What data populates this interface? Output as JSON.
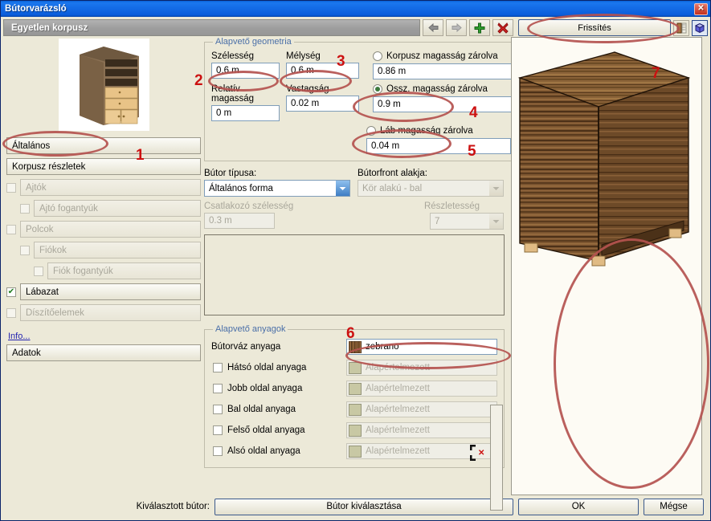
{
  "window": {
    "title": "Bútorvarázsló",
    "close_label": "✕",
    "step_header": "Egyetlen korpusz"
  },
  "toolbar": {
    "back_icon": "arrow-left-icon",
    "forward_icon": "arrow-right-icon",
    "add_icon": "plus-icon",
    "delete_icon": "red-x-icon",
    "refresh_label": "Frissítés",
    "texture_icon": "texture-icon",
    "cube_icon": "cube-3d-icon"
  },
  "sidebar": {
    "items": [
      {
        "label": "Általános",
        "indent": 1,
        "checkbox": "none",
        "enabled": true
      },
      {
        "label": "Korpusz részletek",
        "indent": 1,
        "checkbox": "none",
        "enabled": true
      },
      {
        "label": "Ajtók",
        "indent": 1,
        "checkbox": "unchecked",
        "enabled": false
      },
      {
        "label": "Ajtó fogantyúk",
        "indent": 2,
        "checkbox": "unchecked",
        "enabled": false
      },
      {
        "label": "Polcok",
        "indent": 1,
        "checkbox": "unchecked",
        "enabled": false
      },
      {
        "label": "Fiókok",
        "indent": 2,
        "checkbox": "unchecked",
        "enabled": false
      },
      {
        "label": "Fiók fogantyúk",
        "indent": 3,
        "checkbox": "unchecked",
        "enabled": false
      },
      {
        "label": "Lábazat",
        "indent": 1,
        "checkbox": "checked",
        "enabled": true
      },
      {
        "label": "Díszítőelemek",
        "indent": 1,
        "checkbox": "unchecked",
        "enabled": false
      }
    ],
    "info_link": "Info...",
    "data_button": "Adatok"
  },
  "geometry": {
    "legend": "Alapvető geometria",
    "width_label": "Szélesség",
    "width_value": "0.6 m",
    "depth_label": "Mélység",
    "depth_value": "0.6 m",
    "relative_height_label": "Relatív magasság",
    "relative_height_value": "0 m",
    "thickness_label": "Vastagság",
    "thickness_value": "0.02 m",
    "lock_body_label": "Korpusz magasság zárolva",
    "lock_body_value": "0.86 m",
    "lock_body_selected": false,
    "lock_total_label": "Ossz. magasság zárolva",
    "lock_total_value": "0.9 m",
    "lock_total_selected": true,
    "lock_leg_label": "Láb magasság zárolva",
    "lock_leg_value": "0.04 m",
    "lock_leg_selected": false
  },
  "types": {
    "furniture_type_label": "Bútor típusa:",
    "furniture_type_value": "Általános forma",
    "front_shape_label": "Bútorfront alakja:",
    "front_shape_value": "Kör alakú - bal",
    "connector_width_label": "Csatlakozó szélesség",
    "connector_width_value": "0.3 m",
    "detail_label": "Részletesség",
    "detail_value": "7"
  },
  "materials": {
    "legend": "Alapvető anyagok",
    "frame_label": "Bútorváz anyaga",
    "frame_value": "zebrano",
    "rows": [
      {
        "label": "Hátsó oldal anyaga",
        "value": "Alapértelmezett",
        "checked": false
      },
      {
        "label": "Jobb oldal anyaga",
        "value": "Alapértelmezett",
        "checked": false
      },
      {
        "label": "Bal oldal anyaga",
        "value": "Alapértelmezett",
        "checked": false
      },
      {
        "label": "Felső oldal anyaga",
        "value": "Alapértelmezett",
        "checked": false
      },
      {
        "label": "Alsó oldal anyaga",
        "value": "Alapértelmezett",
        "checked": false
      }
    ],
    "clear_icon": "clear-selection-icon"
  },
  "footer": {
    "selected_label": "Kiválasztott bútor:",
    "select_button": "Bútor kiválasztása",
    "ok_button": "OK",
    "cancel_button": "Mégse"
  },
  "annotations": {
    "markers": [
      "1",
      "2",
      "3",
      "4",
      "5",
      "6",
      "7"
    ],
    "color": "#cc1111",
    "ellipse_color": "#b4524f"
  }
}
